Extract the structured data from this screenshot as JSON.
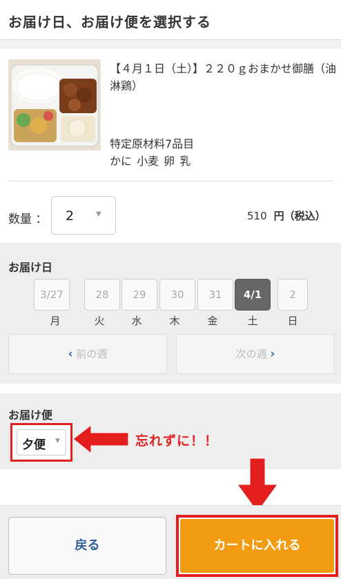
{
  "header": {
    "title": "お届け日、お届け便を選択する"
  },
  "product": {
    "name": "【４月１日（土）】２２０ｇおまかせ御膳（油淋鶏）",
    "allergen_title": "特定原材料7品目",
    "allergens": "かに 小麦 卵 乳"
  },
  "quantity": {
    "label": "数量 ：",
    "value": "2",
    "caret": "▼"
  },
  "price": {
    "amount": "510",
    "unit": "円（税込）"
  },
  "delivery_date": {
    "label": "お届け日",
    "dates": [
      {
        "date": "3/27",
        "dow": "月",
        "selected": false
      },
      {
        "date": "28",
        "dow": "火",
        "selected": false
      },
      {
        "date": "29",
        "dow": "水",
        "selected": false
      },
      {
        "date": "30",
        "dow": "木",
        "selected": false
      },
      {
        "date": "31",
        "dow": "金",
        "selected": false
      },
      {
        "date": "4/1",
        "dow": "土",
        "selected": true
      },
      {
        "date": "2",
        "dow": "日",
        "selected": false
      }
    ],
    "prev_week": "前の週",
    "next_week": "次の週"
  },
  "delivery_slot": {
    "label": "お届け便",
    "value": "夕便",
    "caret": "▼"
  },
  "annotation": {
    "note": "忘れずに！！",
    "highlight_color": "#e02020"
  },
  "footer": {
    "back_label": "戻る",
    "cart_label": "カートに入れる"
  },
  "colors": {
    "accent": "#f39c12",
    "selected_date": "#666666",
    "link": "#2f5e96"
  },
  "icons": {
    "prev_arrow": "chevron-left-icon",
    "next_arrow": "chevron-right-icon",
    "caret": "caret-down-icon"
  }
}
